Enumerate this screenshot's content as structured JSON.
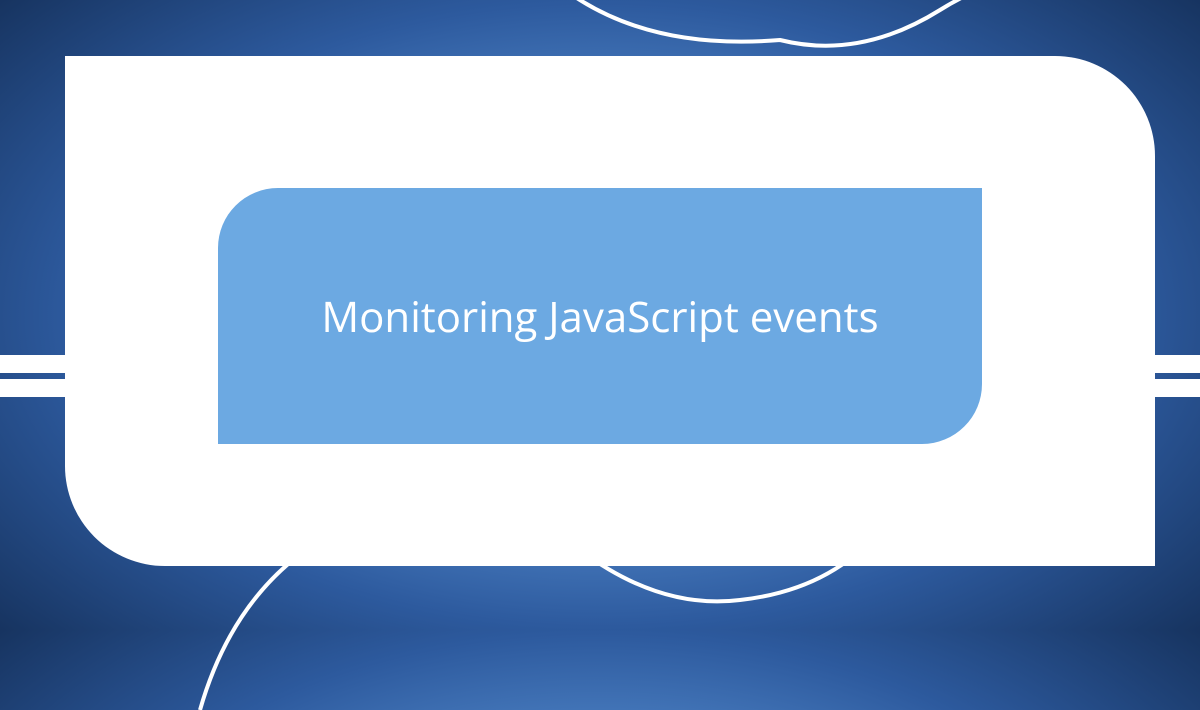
{
  "title": "Monitoring JavaScript events",
  "colors": {
    "background_dark": "#0a1e3d",
    "background_mid": "#2d5a9e",
    "background_light": "#6ca9e6",
    "inner_blue": "#6ca9e2",
    "white": "#ffffff"
  }
}
